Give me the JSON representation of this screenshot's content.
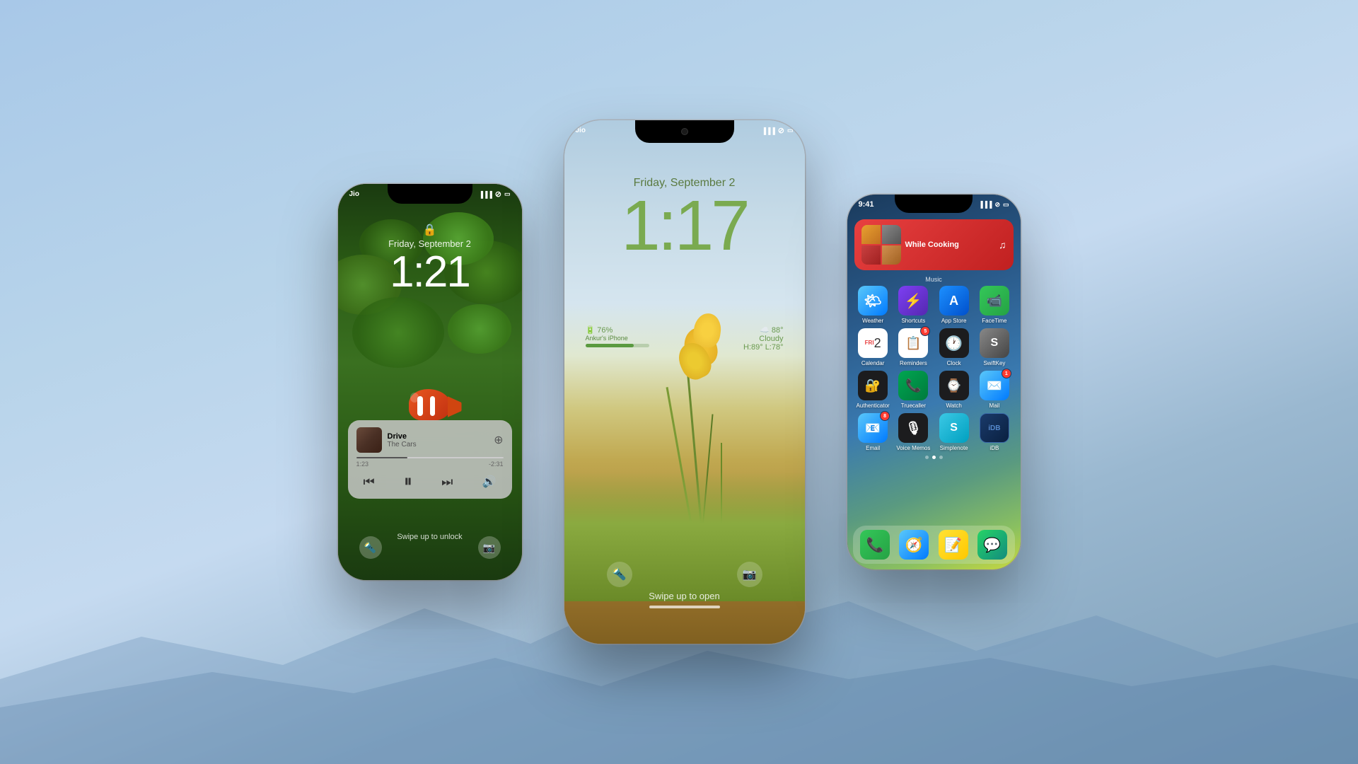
{
  "background": {
    "color_top": "#a8c8e8",
    "color_bottom": "#7a9bb5"
  },
  "phone_left": {
    "status": {
      "carrier": "Jio",
      "signal": "▓▓▓▓",
      "wifi": "wifi",
      "battery": "battery"
    },
    "lock": {
      "date": "Friday, September 2",
      "time": "1:21",
      "swipe_text": "Swipe up to unlock"
    },
    "music": {
      "song": "Drive",
      "artist": "The Cars",
      "time_current": "1:23",
      "time_remaining": "-2:31"
    }
  },
  "phone_center": {
    "status": {
      "carrier": "Jio",
      "signal": "▓▓▓",
      "wifi": "wifi",
      "battery": "battery"
    },
    "lock": {
      "date": "Friday, September 2",
      "time": "1:17",
      "swipe_text": "Swipe up to open"
    },
    "battery_widget": {
      "percent": "76%",
      "label": "Ankur's iPhone"
    },
    "weather_widget": {
      "temp": "88°",
      "condition": "Cloudy",
      "high": "H:89°",
      "low": "L:78°"
    }
  },
  "phone_right": {
    "status": {
      "time": "9:41",
      "signal": "▓▓▓",
      "wifi": "wifi",
      "battery": "battery"
    },
    "now_playing": {
      "title": "While Cooking",
      "label": "Music"
    },
    "apps_row1": [
      {
        "name": "Weather",
        "icon_class": "icon-weather"
      },
      {
        "name": "Shortcuts",
        "icon_class": "icon-shortcuts"
      },
      {
        "name": "App Store",
        "icon_class": "icon-appstore"
      },
      {
        "name": "FaceTime",
        "icon_class": "icon-facetime"
      }
    ],
    "apps_row2": [
      {
        "name": "Calendar",
        "icon_class": "icon-calendar"
      },
      {
        "name": "Reminders",
        "icon_class": "icon-reminders",
        "badge": "5"
      },
      {
        "name": "Clock",
        "icon_class": "icon-clock"
      },
      {
        "name": "SwiftKey",
        "icon_class": "icon-swiftkey"
      }
    ],
    "apps_row3": [
      {
        "name": "Authenticator",
        "icon_class": "icon-auth"
      },
      {
        "name": "Truecaller",
        "icon_class": "icon-truecaller"
      },
      {
        "name": "Watch",
        "icon_class": "icon-watch"
      },
      {
        "name": "Mail",
        "icon_class": "icon-mail",
        "badge": "1"
      }
    ],
    "apps_row4": [
      {
        "name": "Email",
        "icon_class": "icon-mail2",
        "badge": "8"
      },
      {
        "name": "Voice Memos",
        "icon_class": "icon-voicememos"
      },
      {
        "name": "Simplenote",
        "icon_class": "icon-simplenote"
      },
      {
        "name": "iDB",
        "icon_class": "icon-idb"
      }
    ],
    "page_dots": [
      false,
      true,
      false
    ],
    "dock": [
      {
        "name": "Phone",
        "icon_class": "icon-phone"
      },
      {
        "name": "Safari",
        "icon_class": "icon-safari"
      },
      {
        "name": "Notes",
        "icon_class": "icon-notes"
      },
      {
        "name": "WhatsApp",
        "icon_class": "icon-whatsapp"
      }
    ]
  }
}
